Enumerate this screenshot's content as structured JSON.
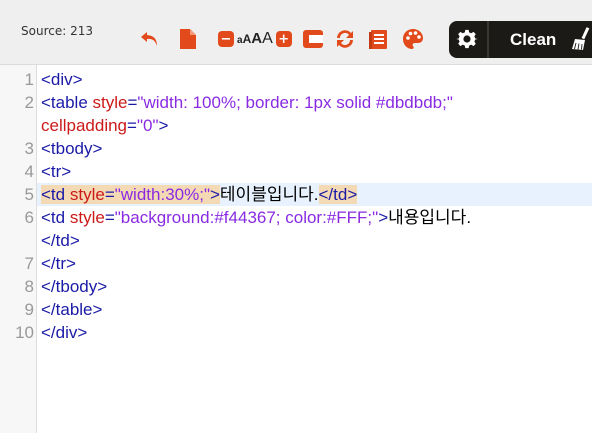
{
  "toolbar": {
    "source_label": "Source: 213",
    "font_size_decrease": "−",
    "font_size_increase": "+",
    "font_size_glyphs": [
      "A",
      "A",
      "A"
    ],
    "font_size_prefix": "a",
    "clean_label": "Clean"
  },
  "colors": {
    "toolbar_bg": "#efefef",
    "icon_accent": "#e24a1c",
    "clean_panel_bg": "#1c1a16",
    "tag": "#1a1aa6",
    "attribute": "#cc1a1a",
    "string": "#8a2be2",
    "active_line": "#e8f2ff",
    "bracket_match": "#f4d9b5"
  },
  "icons": [
    "undo-icon",
    "new-document-icon",
    "font-size-decrease-icon",
    "font-size-increase-icon",
    "wrap-icon",
    "refresh-icon",
    "document-list-icon",
    "palette-icon",
    "gear-icon",
    "broom-icon"
  ],
  "editor": {
    "active_line": 5,
    "line_numbers": [
      "1",
      "2",
      "",
      "3",
      "4",
      "5",
      "6",
      "",
      "7",
      "8",
      "9",
      "10"
    ],
    "lines": [
      [
        {
          "t": "tag",
          "v": "<div>"
        }
      ],
      [
        {
          "t": "tag",
          "v": "<table "
        },
        {
          "t": "attr",
          "v": "style"
        },
        {
          "t": "tag",
          "v": "="
        },
        {
          "t": "str",
          "v": "\"width: 100%; border: 1px solid #dbdbdb;\""
        }
      ],
      [
        {
          "t": "attr",
          "v": "cellpadding"
        },
        {
          "t": "tag",
          "v": "="
        },
        {
          "t": "str",
          "v": "\"0\""
        },
        {
          "t": "tag",
          "v": ">"
        }
      ],
      [
        {
          "t": "tag",
          "v": "<tbody>"
        }
      ],
      [
        {
          "t": "tag",
          "v": "<tr>"
        }
      ],
      [
        {
          "t": "tag",
          "v": "<td ",
          "m": true
        },
        {
          "t": "attr",
          "v": "style",
          "m": true
        },
        {
          "t": "tag",
          "v": "=",
          "m": true
        },
        {
          "t": "str",
          "v": "\"width:30%;\"",
          "m": true
        },
        {
          "t": "tag",
          "v": ">",
          "m": true
        },
        {
          "t": "txt",
          "v": "테이블입니다."
        },
        {
          "t": "tag",
          "v": "</td>",
          "m": true
        }
      ],
      [
        {
          "t": "tag",
          "v": "<td "
        },
        {
          "t": "attr",
          "v": "style"
        },
        {
          "t": "tag",
          "v": "="
        },
        {
          "t": "str",
          "v": "\"background:#f44367; color:#FFF;\""
        },
        {
          "t": "tag",
          "v": ">"
        },
        {
          "t": "txt",
          "v": "내용입니다."
        }
      ],
      [
        {
          "t": "tag",
          "v": "</td>"
        }
      ],
      [
        {
          "t": "tag",
          "v": "</tr>"
        }
      ],
      [
        {
          "t": "tag",
          "v": "</tbody>"
        }
      ],
      [
        {
          "t": "tag",
          "v": "</table>"
        }
      ],
      [
        {
          "t": "tag",
          "v": "</div>"
        }
      ]
    ]
  }
}
